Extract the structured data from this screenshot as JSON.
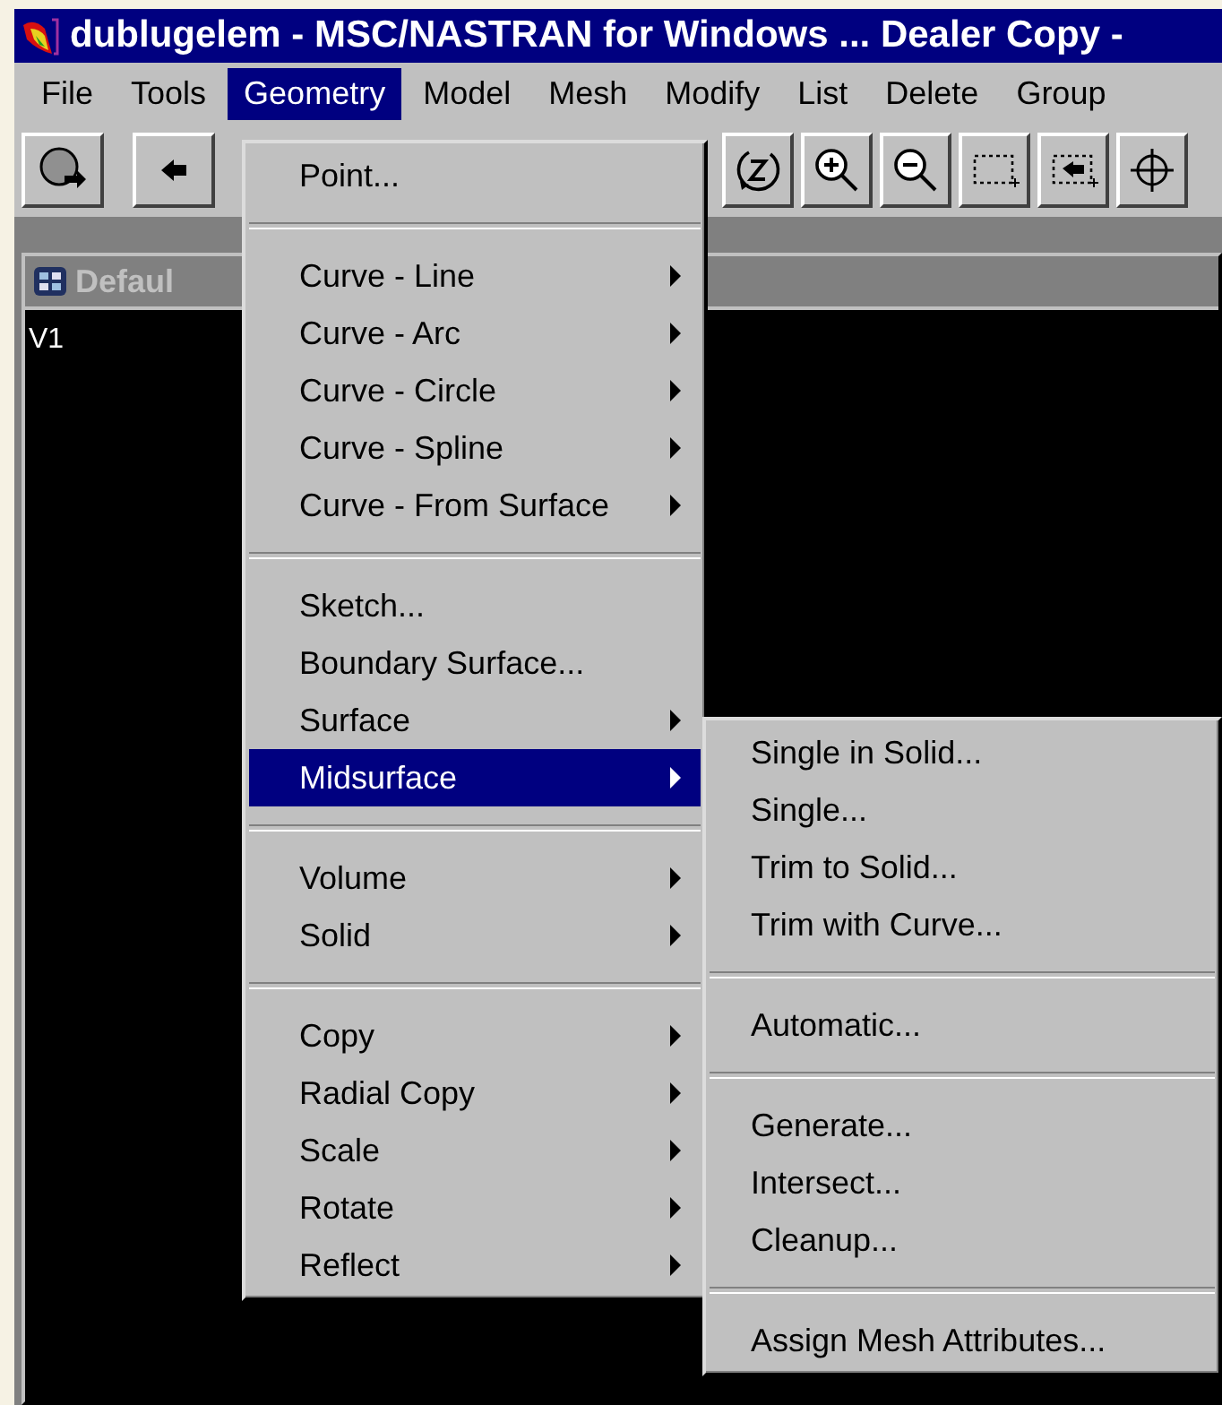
{
  "window": {
    "title": "dublugelem - MSC/NASTRAN for Windows ... Dealer Copy -"
  },
  "menu_bar": [
    {
      "label": "File",
      "selected": false
    },
    {
      "label": "Tools",
      "selected": false
    },
    {
      "label": "Geometry",
      "selected": true
    },
    {
      "label": "Model",
      "selected": false
    },
    {
      "label": "Mesh",
      "selected": false
    },
    {
      "label": "Modify",
      "selected": false
    },
    {
      "label": "List",
      "selected": false
    },
    {
      "label": "Delete",
      "selected": false
    },
    {
      "label": "Group",
      "selected": false
    }
  ],
  "child_window": {
    "title": "Defaul",
    "view_label": "V1"
  },
  "geometry_menu": {
    "items": [
      {
        "kind": "item",
        "label": "Point...",
        "submenu": false,
        "selected": false
      },
      {
        "kind": "separator"
      },
      {
        "kind": "item",
        "label": "Curve - Line",
        "submenu": true,
        "selected": false
      },
      {
        "kind": "item",
        "label": "Curve - Arc",
        "submenu": true,
        "selected": false
      },
      {
        "kind": "item",
        "label": "Curve - Circle",
        "submenu": true,
        "selected": false
      },
      {
        "kind": "item",
        "label": "Curve - Spline",
        "submenu": true,
        "selected": false
      },
      {
        "kind": "item",
        "label": "Curve - From Surface",
        "submenu": true,
        "selected": false
      },
      {
        "kind": "separator"
      },
      {
        "kind": "item",
        "label": "Sketch...",
        "submenu": false,
        "selected": false
      },
      {
        "kind": "item",
        "label": "Boundary Surface...",
        "submenu": false,
        "selected": false
      },
      {
        "kind": "item",
        "label": "Surface",
        "submenu": true,
        "selected": false
      },
      {
        "kind": "item",
        "label": "Midsurface",
        "submenu": true,
        "selected": true
      },
      {
        "kind": "separator"
      },
      {
        "kind": "item",
        "label": "Volume",
        "submenu": true,
        "selected": false
      },
      {
        "kind": "item",
        "label": "Solid",
        "submenu": true,
        "selected": false
      },
      {
        "kind": "separator"
      },
      {
        "kind": "item",
        "label": "Copy",
        "submenu": true,
        "selected": false
      },
      {
        "kind": "item",
        "label": "Radial Copy",
        "submenu": true,
        "selected": false
      },
      {
        "kind": "item",
        "label": "Scale",
        "submenu": true,
        "selected": false
      },
      {
        "kind": "item",
        "label": "Rotate",
        "submenu": true,
        "selected": false
      },
      {
        "kind": "item",
        "label": "Reflect",
        "submenu": true,
        "selected": false
      }
    ]
  },
  "midsurface_submenu": {
    "items": [
      {
        "kind": "item",
        "label": "Single in Solid...",
        "submenu": false,
        "selected": false
      },
      {
        "kind": "item",
        "label": "Single...",
        "submenu": false,
        "selected": false
      },
      {
        "kind": "item",
        "label": "Trim to Solid...",
        "submenu": false,
        "selected": false
      },
      {
        "kind": "item",
        "label": "Trim with Curve...",
        "submenu": false,
        "selected": false
      },
      {
        "kind": "separator"
      },
      {
        "kind": "item",
        "label": "Automatic...",
        "submenu": false,
        "selected": false
      },
      {
        "kind": "separator"
      },
      {
        "kind": "item",
        "label": "Generate...",
        "submenu": false,
        "selected": false
      },
      {
        "kind": "item",
        "label": "Intersect...",
        "submenu": false,
        "selected": false
      },
      {
        "kind": "item",
        "label": "Cleanup...",
        "submenu": false,
        "selected": false
      },
      {
        "kind": "separator"
      },
      {
        "kind": "item",
        "label": "Assign Mesh Attributes...",
        "submenu": false,
        "selected": false
      }
    ]
  }
}
